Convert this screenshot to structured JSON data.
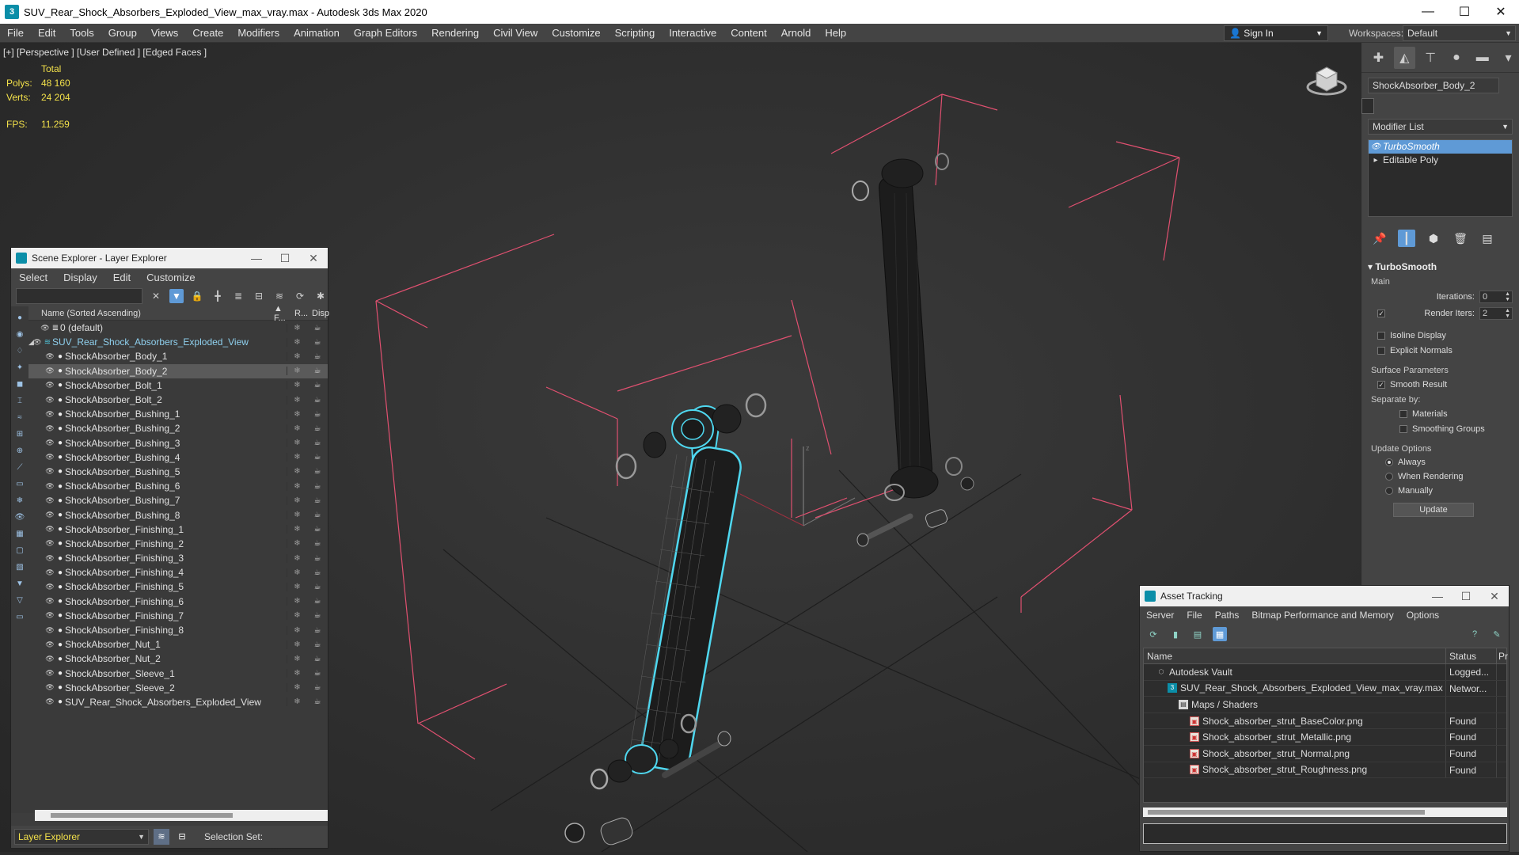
{
  "window": {
    "title": "SUV_Rear_Shock_Absorbers_Exploded_View_max_vray.max - Autodesk 3ds Max 2020",
    "minimize": "—",
    "maximize": "☐",
    "close": "✕"
  },
  "menu": {
    "items": [
      "File",
      "Edit",
      "Tools",
      "Group",
      "Views",
      "Create",
      "Modifiers",
      "Animation",
      "Graph Editors",
      "Rendering",
      "Civil View",
      "Customize",
      "Scripting",
      "Interactive",
      "Content",
      "Arnold",
      "Help"
    ],
    "sign_in": "Sign In",
    "workspaces_label": "Workspaces:",
    "workspace_value": "Default"
  },
  "viewport": {
    "label": "[+] [Perspective ] [User Defined ] [Edged Faces ]",
    "stats_total": "Total",
    "polys_label": "Polys:",
    "polys_value": "48 160",
    "verts_label": "Verts:",
    "verts_value": "24 204",
    "fps_label": "FPS:",
    "fps_value": "11.259"
  },
  "command_panel": {
    "object_name": "ShockAbsorber_Body_2",
    "modifier_list": "Modifier List",
    "stack": [
      {
        "label": "TurboSmooth",
        "selected": true
      },
      {
        "label": "Editable Poly",
        "selected": false
      }
    ],
    "turbosmooth": {
      "title": "TurboSmooth",
      "main": "Main",
      "iterations_label": "Iterations:",
      "iterations_value": "0",
      "render_iters_label": "Render Iters:",
      "render_iters_value": "2",
      "isoline_display": "Isoline Display",
      "explicit_normals": "Explicit Normals",
      "surface_parameters": "Surface Parameters",
      "smooth_result": "Smooth Result",
      "separate_by": "Separate by:",
      "materials": "Materials",
      "smoothing_groups": "Smoothing Groups",
      "update_options": "Update Options",
      "always": "Always",
      "when_rendering": "When Rendering",
      "manually": "Manually",
      "update_button": "Update"
    }
  },
  "scene_explorer": {
    "title": "Scene Explorer - Layer Explorer",
    "menu": [
      "Select",
      "Display",
      "Edit",
      "Customize"
    ],
    "col_name": "Name (Sorted Ascending)",
    "col_f": "▲ F...",
    "col_r": "R...",
    "col_d": "Disp",
    "rows": [
      {
        "name": "0 (default)",
        "level": 1
      },
      {
        "name": "SUV_Rear_Shock_Absorbers_Exploded_View",
        "level": 0
      },
      {
        "name": "ShockAbsorber_Body_1",
        "level": 2
      },
      {
        "name": "ShockAbsorber_Body_2",
        "level": 2
      },
      {
        "name": "ShockAbsorber_Bolt_1",
        "level": 2
      },
      {
        "name": "ShockAbsorber_Bolt_2",
        "level": 2
      },
      {
        "name": "ShockAbsorber_Bushing_1",
        "level": 2
      },
      {
        "name": "ShockAbsorber_Bushing_2",
        "level": 2
      },
      {
        "name": "ShockAbsorber_Bushing_3",
        "level": 2
      },
      {
        "name": "ShockAbsorber_Bushing_4",
        "level": 2
      },
      {
        "name": "ShockAbsorber_Bushing_5",
        "level": 2
      },
      {
        "name": "ShockAbsorber_Bushing_6",
        "level": 2
      },
      {
        "name": "ShockAbsorber_Bushing_7",
        "level": 2
      },
      {
        "name": "ShockAbsorber_Bushing_8",
        "level": 2
      },
      {
        "name": "ShockAbsorber_Finishing_1",
        "level": 2
      },
      {
        "name": "ShockAbsorber_Finishing_2",
        "level": 2
      },
      {
        "name": "ShockAbsorber_Finishing_3",
        "level": 2
      },
      {
        "name": "ShockAbsorber_Finishing_4",
        "level": 2
      },
      {
        "name": "ShockAbsorber_Finishing_5",
        "level": 2
      },
      {
        "name": "ShockAbsorber_Finishing_6",
        "level": 2
      },
      {
        "name": "ShockAbsorber_Finishing_7",
        "level": 2
      },
      {
        "name": "ShockAbsorber_Finishing_8",
        "level": 2
      },
      {
        "name": "ShockAbsorber_Nut_1",
        "level": 2
      },
      {
        "name": "ShockAbsorber_Nut_2",
        "level": 2
      },
      {
        "name": "ShockAbsorber_Sleeve_1",
        "level": 2
      },
      {
        "name": "ShockAbsorber_Sleeve_2",
        "level": 2
      },
      {
        "name": "SUV_Rear_Shock_Absorbers_Exploded_View",
        "level": 2
      }
    ],
    "selected_row": "ShockAbsorber_Body_2",
    "layer_selector": "Layer Explorer",
    "selection_set": "Selection Set:"
  },
  "asset_tracking": {
    "title": "Asset Tracking",
    "menu": [
      "Server",
      "File",
      "Paths",
      "Bitmap Performance and Memory",
      "Options"
    ],
    "col_name": "Name",
    "col_status": "Status",
    "col_p": "Pr",
    "rows": [
      {
        "name": "Autodesk Vault",
        "status": "Logged...",
        "icon": "vault",
        "indent": 0
      },
      {
        "name": "SUV_Rear_Shock_Absorbers_Exploded_View_max_vray.max",
        "status": "Networ...",
        "icon": "max",
        "indent": 1
      },
      {
        "name": "Maps / Shaders",
        "status": "",
        "icon": "folder",
        "indent": 2
      },
      {
        "name": "Shock_absorber_strut_BaseColor.png",
        "status": "Found",
        "icon": "png",
        "indent": 3
      },
      {
        "name": "Shock_absorber_strut_Metallic.png",
        "status": "Found",
        "icon": "png",
        "indent": 3
      },
      {
        "name": "Shock_absorber_strut_Normal.png",
        "status": "Found",
        "icon": "png",
        "indent": 3
      },
      {
        "name": "Shock_absorber_strut_Roughness.png",
        "status": "Found",
        "icon": "png",
        "indent": 3
      }
    ]
  },
  "colors": {
    "selection_highlight": "#5f9ad6",
    "stats_text": "#f2e04a",
    "bounding_box": "#e05070",
    "selected_wire": "#4fd8f0"
  }
}
